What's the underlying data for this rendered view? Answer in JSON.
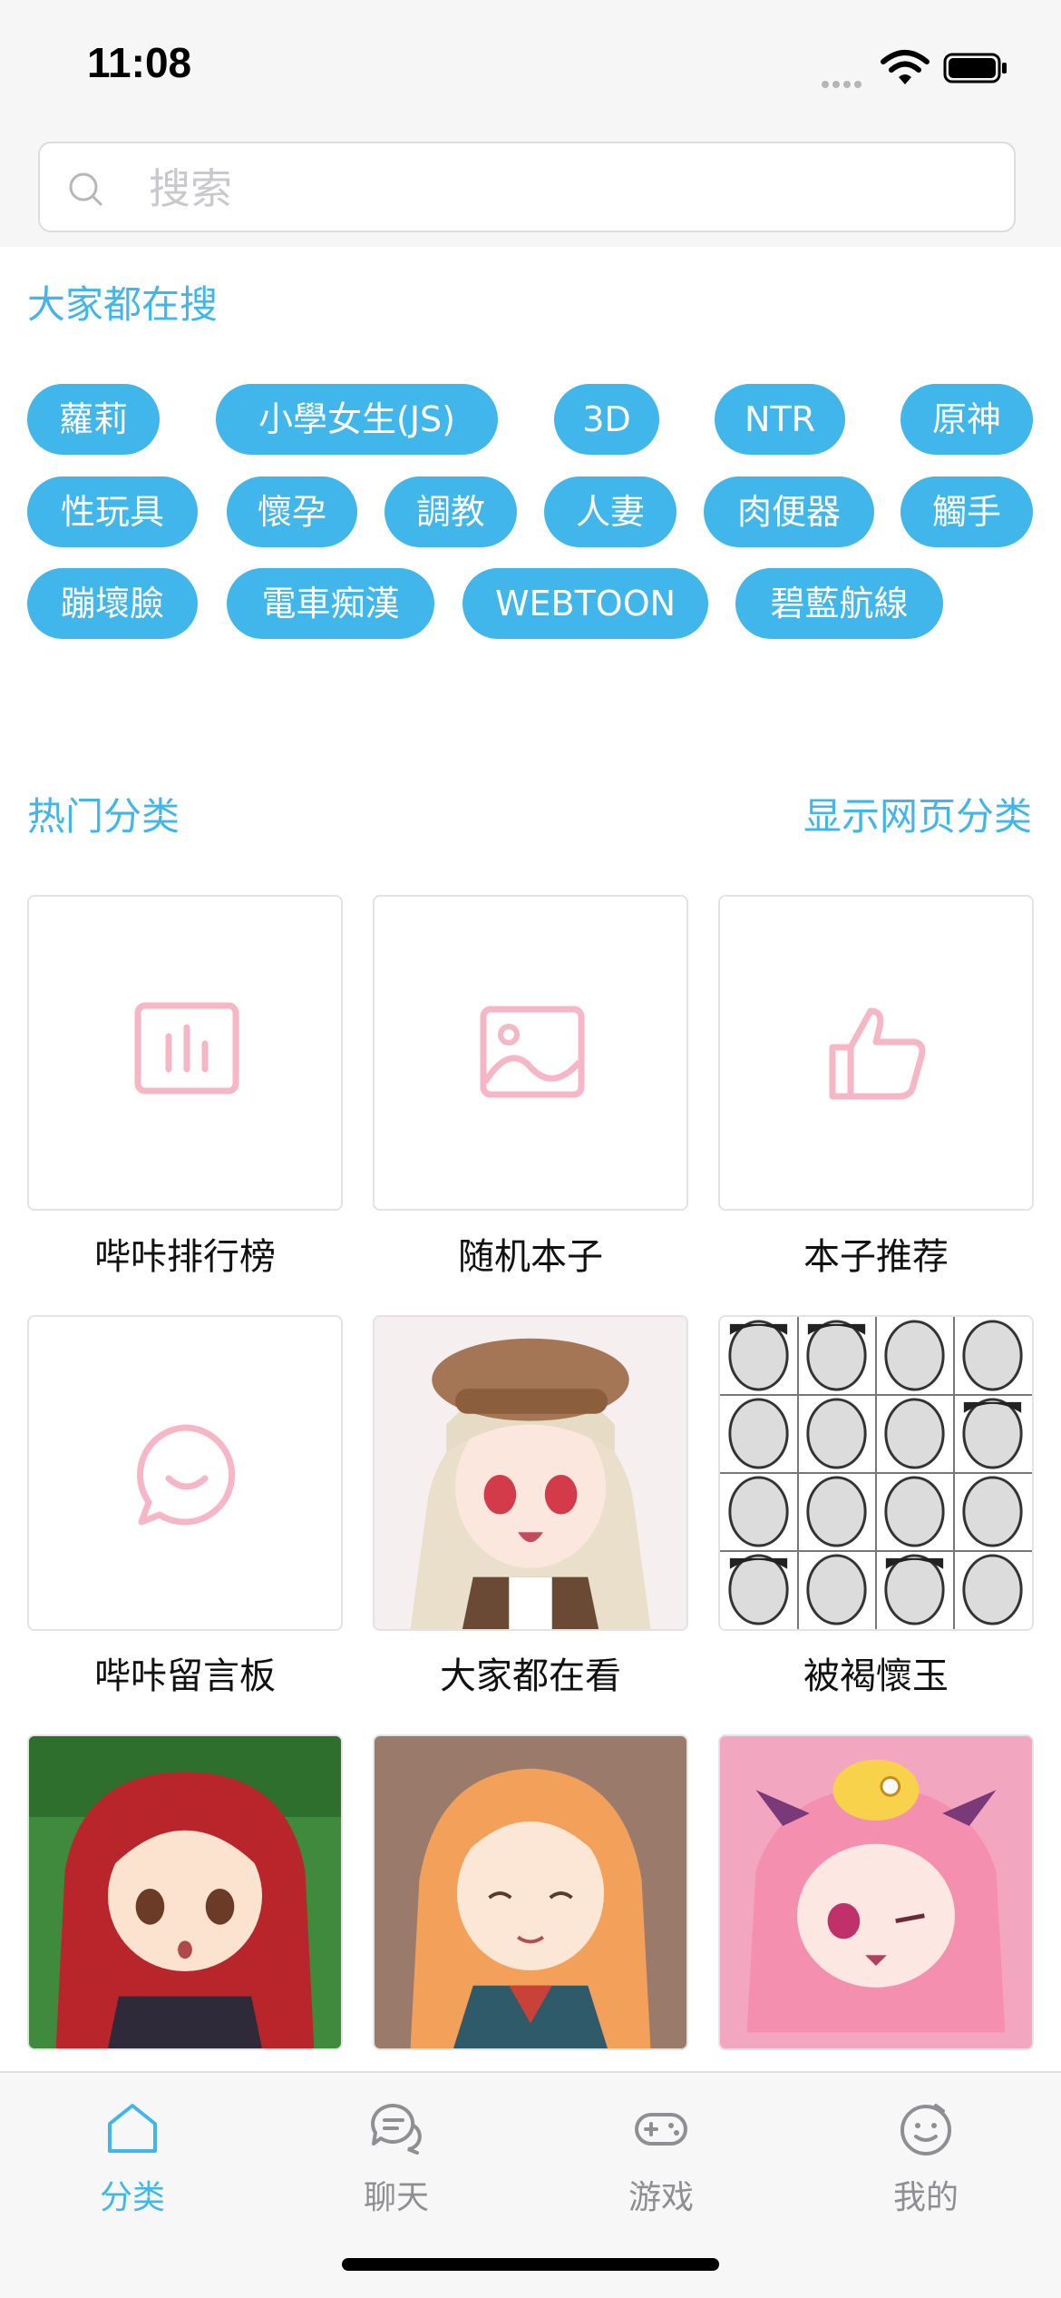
{
  "status": {
    "time": "11:08"
  },
  "search": {
    "placeholder": "搜索"
  },
  "trending": {
    "title": "大家都在搜",
    "tags": [
      "蘿莉",
      "小學女生(JS)",
      "3D",
      "NTR",
      "原神",
      "性玩具",
      "懷孕",
      "調教",
      "人妻",
      "肉便器",
      "觸手",
      "蹦壞臉",
      "電車痴漢",
      "WEBTOON",
      "碧藍航線"
    ]
  },
  "categories": {
    "title": "热门分类",
    "show_web": "显示网页分类",
    "items": [
      {
        "label": "哔咔排行榜",
        "icon": "bar-chart-icon"
      },
      {
        "label": "随机本子",
        "icon": "image-icon"
      },
      {
        "label": "本子推荐",
        "icon": "thumbs-up-icon"
      },
      {
        "label": "哔咔留言板",
        "icon": "chat-bubble-icon"
      },
      {
        "label": "大家都在看",
        "icon": "anime-girl-cap-thumbnail"
      },
      {
        "label": "被褐懷玉",
        "icon": "manga-faces-thumbnail"
      },
      {
        "label": "",
        "icon": "red-hair-girl-thumbnail"
      },
      {
        "label": "",
        "icon": "orange-hair-girl-thumbnail"
      },
      {
        "label": "",
        "icon": "pink-hair-chibi-thumbnail"
      }
    ]
  },
  "tabs": [
    {
      "label": "分类",
      "icon": "home-icon",
      "active": true
    },
    {
      "label": "聊天",
      "icon": "chat-icon",
      "active": false
    },
    {
      "label": "游戏",
      "icon": "gamepad-icon",
      "active": false
    },
    {
      "label": "我的",
      "icon": "smiley-icon",
      "active": false
    }
  ],
  "colors": {
    "accent": "#41b6ea",
    "icon_pink": "#f7b6c6",
    "inactive": "#8e8e93"
  }
}
